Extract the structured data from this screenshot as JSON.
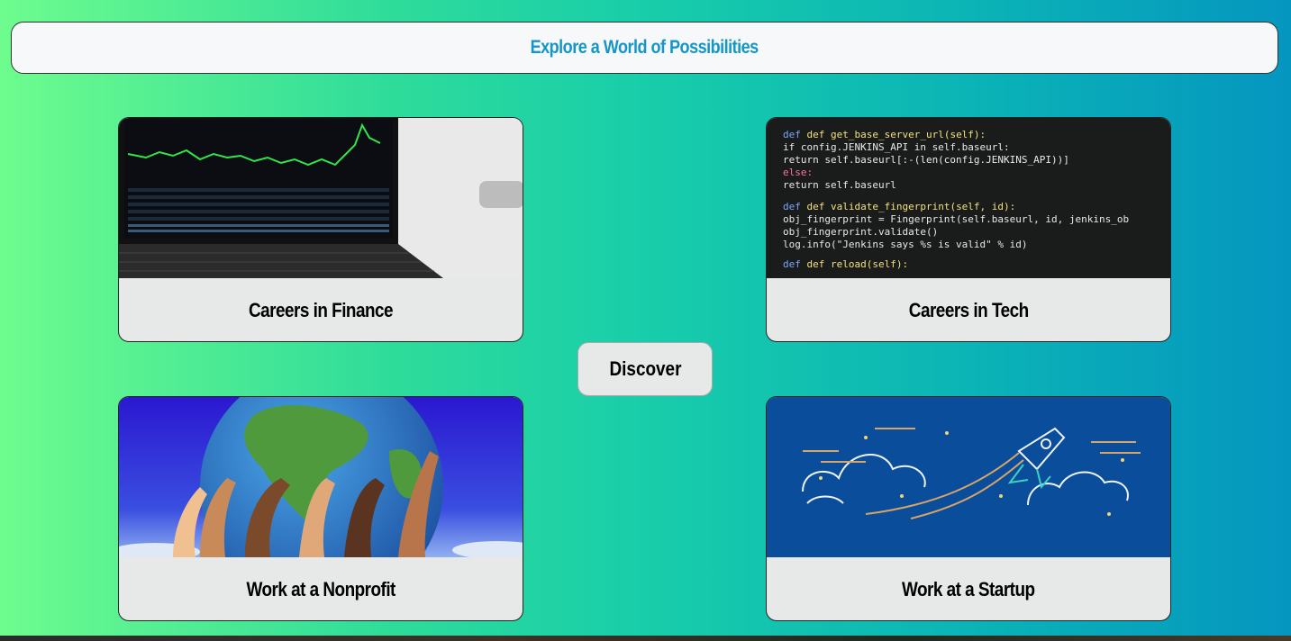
{
  "header": {
    "title": "Explore a World of Possibilities"
  },
  "cards": [
    {
      "label": "Careers in Finance",
      "image": "laptop-stock-chart"
    },
    {
      "label": "Careers in Tech",
      "image": "code-screen"
    },
    {
      "label": "Work at a Nonprofit",
      "image": "hands-holding-globe"
    },
    {
      "label": "Work at a Startup",
      "image": "rocket-illustration"
    }
  ],
  "discover_button": {
    "label": "Discover"
  },
  "code_lines": [
    "def get_base_server_url(self):",
    "    if config.JENKINS_API in self.baseurl:",
    "        return self.baseurl[:-(len(config.JENKINS_API))]",
    "    else:",
    "        return self.baseurl",
    "def validate_fingerprint(self, id):",
    "    obj_fingerprint = Fingerprint(self.baseurl, id, jenkins_ob",
    "    obj_fingerprint.validate()",
    "    log.info(\"Jenkins says %s is valid\" % id)",
    "def reload(self):"
  ],
  "colors": {
    "title": "#1496c8",
    "card_bg": "#e7e8e8",
    "gradient_start": "#6efc8e",
    "gradient_end": "#0596c0"
  }
}
